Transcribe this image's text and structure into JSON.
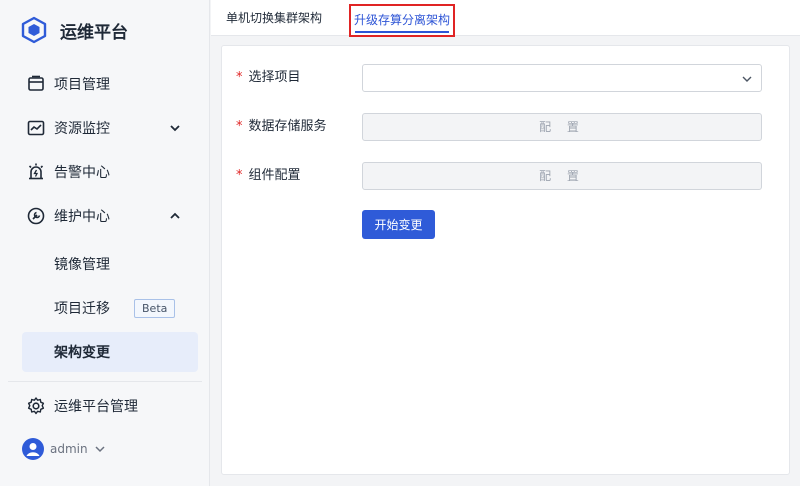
{
  "brand": {
    "title": "运维平台"
  },
  "sidebar": {
    "items": [
      {
        "label": "项目管理",
        "icon": "project-icon"
      },
      {
        "label": "资源监控",
        "icon": "monitor-chart-icon",
        "expanded": false
      },
      {
        "label": "告警中心",
        "icon": "alarm-icon"
      },
      {
        "label": "维护中心",
        "icon": "maintenance-icon",
        "expanded": true
      }
    ],
    "sub_items": [
      {
        "label": "镜像管理"
      },
      {
        "label": "项目迁移",
        "badge": "Beta"
      },
      {
        "label": "架构变更",
        "active": true
      }
    ],
    "platform_admin": {
      "label": "运维平台管理",
      "icon": "gear-icon"
    },
    "user": {
      "name": "admin"
    }
  },
  "tabs": [
    {
      "label": "单机切换集群架构"
    },
    {
      "label": "升级存算分离架构",
      "active": true
    }
  ],
  "form": {
    "project": {
      "label": "选择项目",
      "required_mark": "*",
      "value": ""
    },
    "storage": {
      "label": "数据存储服务",
      "required_mark": "*",
      "button": "配 置"
    },
    "component": {
      "label": "组件配置",
      "required_mark": "*",
      "button": "配 置"
    },
    "submit": "开始变更"
  },
  "colors": {
    "accent": "#2f5bd8",
    "highlight_box": "#e02424",
    "active_bg": "#e7edfa"
  }
}
